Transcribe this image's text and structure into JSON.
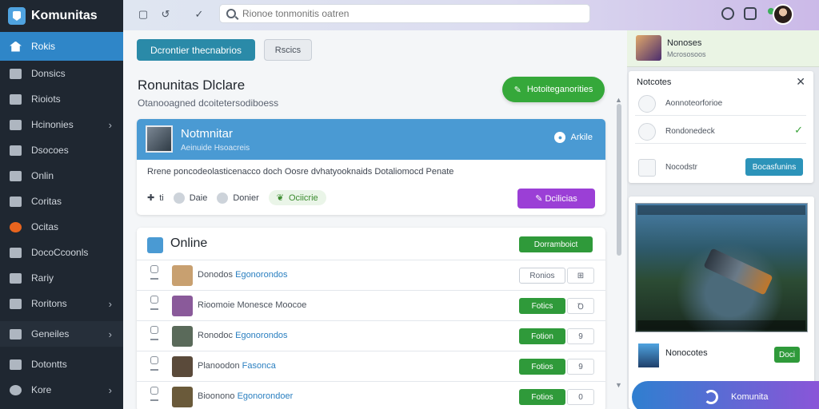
{
  "app": {
    "name": "Komunitas"
  },
  "sidebar": {
    "items": [
      {
        "label": "Rokis",
        "active": true
      },
      {
        "label": "Donsics"
      },
      {
        "label": "Rioiots"
      },
      {
        "label": "Hcinonies",
        "chevron": "›"
      },
      {
        "label": "Dsocoes"
      },
      {
        "label": "Onlin"
      },
      {
        "label": "Coritas"
      },
      {
        "label": "Ocitas"
      },
      {
        "label": "DocoCcoonls"
      },
      {
        "label": "Rariy"
      },
      {
        "label": "Roritons",
        "chevron": "›"
      },
      {
        "label": "Geneiles",
        "chevron": "›"
      },
      {
        "label": "Dotontts"
      },
      {
        "label": "Kore",
        "chevron": "›"
      }
    ]
  },
  "topbar": {
    "search_placeholder": "Rionoe tonmonitis oatren"
  },
  "main": {
    "top_buttons": {
      "primary": "Dcrontier thecnabrios",
      "secondary": "Rscics"
    },
    "title": "Ronunitas Dlclare",
    "subtitle": "Otanooagned dcoitetersodiboess",
    "new_button": "Hotoiteganorities",
    "post": {
      "author": "Notmnitar",
      "meta": "Aeinuide Hsoacreis",
      "status": "Arkile",
      "body": "Rrene poncodeolasticenacco doch Oosre dvhatyooknaids Dotaliomocd Penate",
      "actions": {
        "votes": "ti",
        "first": "Daie",
        "second": "Donier",
        "third": "Ociicrie"
      },
      "purple_button": "Dcilicias"
    },
    "online": {
      "title": "Online",
      "button": "Dorramboict",
      "rows": [
        {
          "name": "Donodos",
          "link": "Egonorondos",
          "action": "Ronios",
          "num": "⊞",
          "outline": true
        },
        {
          "name": "Rioomoie Monesce Moocoe",
          "link": "",
          "action": "Fotics",
          "num": "Ꝺ",
          "outline": false
        },
        {
          "name": "Ronodoc",
          "link": "Egonorondos",
          "action": "Fotion",
          "num": "9",
          "outline": false
        },
        {
          "name": "Planoodon",
          "link": "Fasonca",
          "action": "Fotios",
          "num": "9",
          "outline": false
        },
        {
          "name": "Bioonono",
          "link": "Egonorondoer",
          "action": "Fotios",
          "num": "0",
          "outline": false
        }
      ]
    }
  },
  "right": {
    "profile": {
      "name": "Nonoses",
      "sub": "Mcrososoos"
    },
    "notifications": {
      "title": "Notcotes",
      "rows": [
        {
          "text": "Aonnoteorforioe"
        },
        {
          "text": "Rondonedeck",
          "check": "✓"
        },
        {
          "text": "Nocodstr",
          "button": "Bocasfunins"
        }
      ]
    },
    "game": {
      "name": "Nonocotes",
      "button": "Doci"
    },
    "fab": {
      "label": "Komunita"
    }
  }
}
